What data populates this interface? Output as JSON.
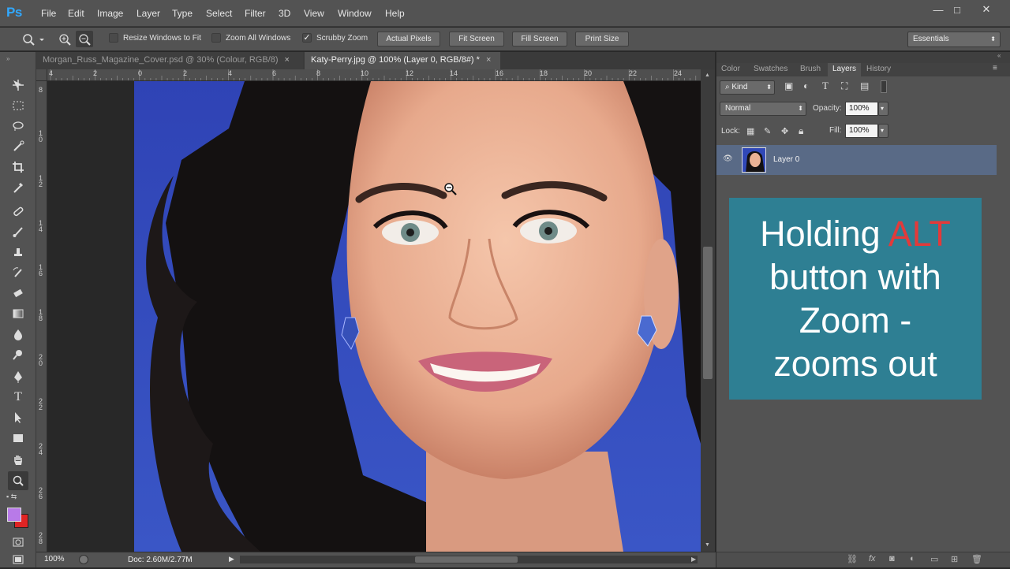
{
  "app": {
    "logo": "Ps"
  },
  "menu": [
    "File",
    "Edit",
    "Image",
    "Layer",
    "Type",
    "Select",
    "Filter",
    "3D",
    "View",
    "Window",
    "Help"
  ],
  "window_controls": {
    "minimize": "—",
    "maximize": "□",
    "close": "✕"
  },
  "options": {
    "resize_windows": {
      "label": "Resize Windows to Fit",
      "checked": false
    },
    "zoom_all": {
      "label": "Zoom All Windows",
      "checked": false
    },
    "scrubby": {
      "label": "Scrubby Zoom",
      "checked": true
    },
    "buttons": [
      "Actual Pixels",
      "Fit Screen",
      "Fill Screen",
      "Print Size"
    ],
    "workspace": "Essentials"
  },
  "tabs": [
    {
      "label": "Morgan_Russ_Magazine_Cover.psd @ 30% (Colour, RGB/8)",
      "close": "×",
      "active": false
    },
    {
      "label": "Katy-Perry.jpg @ 100% (Layer 0, RGB/8#) *",
      "close": "×",
      "active": true
    }
  ],
  "ruler_h": [
    "4",
    "2",
    "0",
    "2",
    "4",
    "6",
    "8",
    "10",
    "12",
    "14",
    "16",
    "18",
    "20",
    "22",
    "24"
  ],
  "ruler_v": [
    "8",
    "1 0",
    "1 2",
    "1 4",
    "1 6",
    "1 8",
    "2 0",
    "2 2",
    "2 4",
    "2 6",
    "2 8"
  ],
  "status": {
    "zoom": "100%",
    "doc": "Doc: 2.60M/2.77M"
  },
  "panel": {
    "tabs": [
      "Color",
      "Swatches",
      "Brush",
      "Layers",
      "History"
    ],
    "active_tab": "Layers",
    "filter_kind": "Kind",
    "blend_mode": "Normal",
    "opacity_label": "Opacity:",
    "opacity": "100%",
    "lock_label": "Lock:",
    "fill_label": "Fill:",
    "fill": "100%",
    "layer_name": "Layer 0"
  },
  "callout": {
    "line1_prefix": "Holding ",
    "line1_highlight": "ALT",
    "line2": "button with",
    "line3": "Zoom -",
    "line4": "zooms out",
    "highlight_color": "#e23a3a",
    "background": "#2e7f93"
  },
  "colors": {
    "foreground": "#b87ae8",
    "background": "#e02424"
  }
}
